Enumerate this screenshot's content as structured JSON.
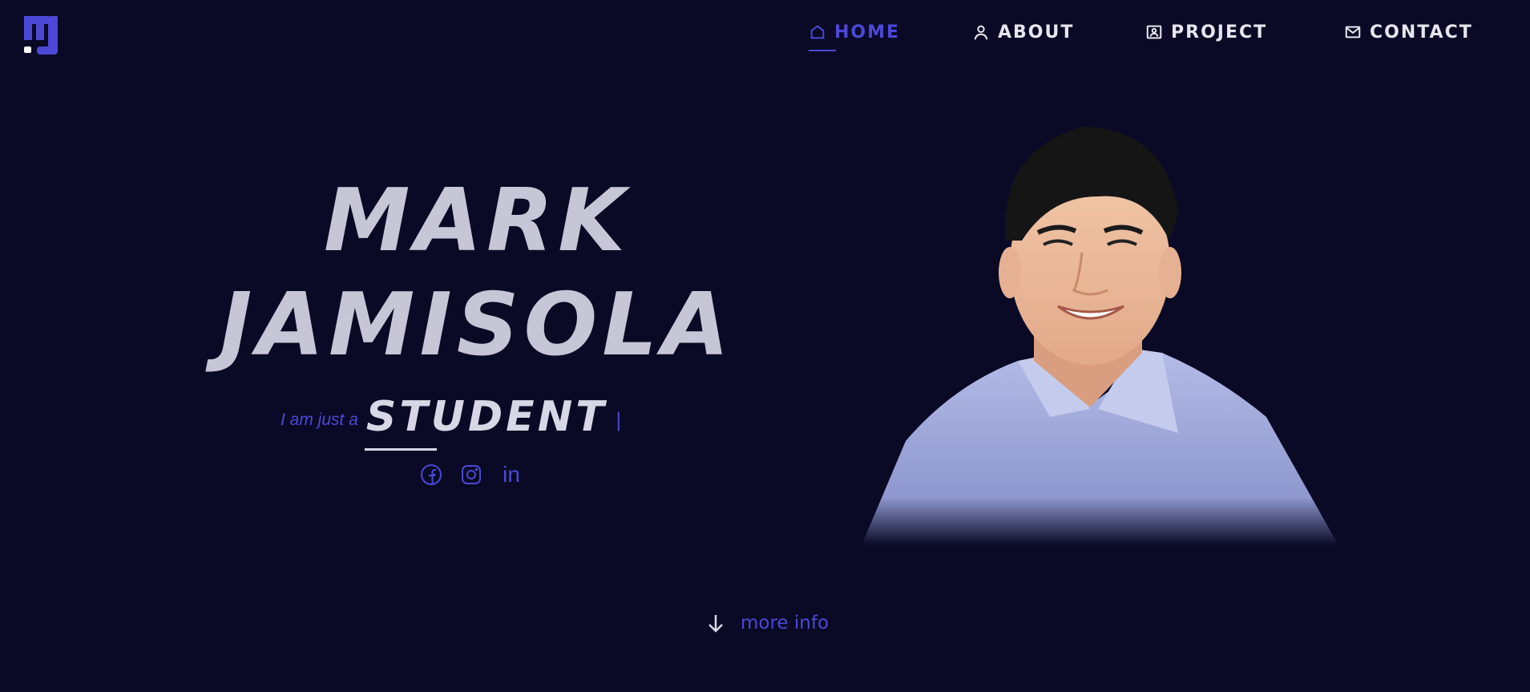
{
  "brand": {
    "logo_icon": "mj-logo-icon",
    "accent": "#4b48d6",
    "background": "#0a0a26"
  },
  "nav": {
    "items": [
      {
        "label": "HOME",
        "icon": "home-icon",
        "active": true
      },
      {
        "label": "ABOUT",
        "icon": "user-icon",
        "active": false
      },
      {
        "label": "PROJECT",
        "icon": "id-card-icon",
        "active": false
      },
      {
        "label": "CONTACT",
        "icon": "mail-icon",
        "active": false
      }
    ]
  },
  "hero": {
    "first_name": "MARK",
    "last_name": "JAMISOLA",
    "tagline_prefix": "I am just a",
    "tagline_role": "STUDENT",
    "cursor": "|",
    "social": [
      "facebook-icon",
      "instagram-icon",
      "linkedin-icon"
    ],
    "linkedin_text": "in"
  },
  "more_info": {
    "label": "more info",
    "icon": "arrow-down-icon"
  }
}
